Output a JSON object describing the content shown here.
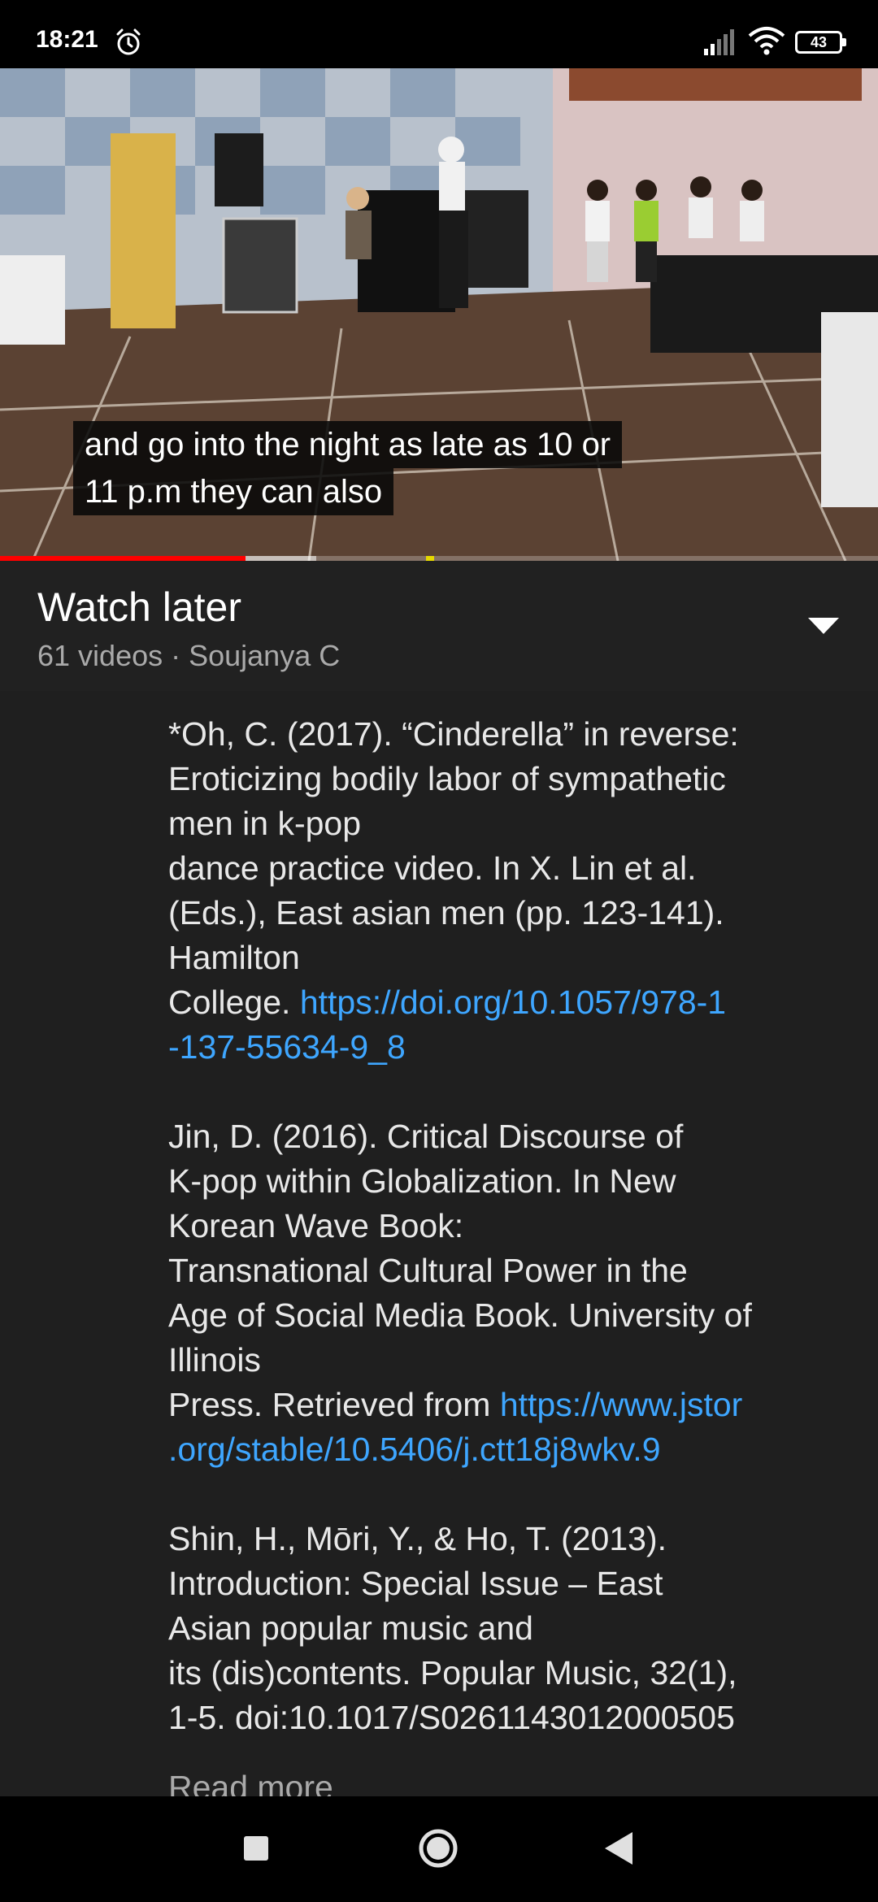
{
  "status_bar": {
    "time": "18:21",
    "battery_level": "43",
    "icons": [
      "alarm-icon",
      "signal-icon",
      "wifi-icon",
      "battery-icon"
    ]
  },
  "video": {
    "caption_lines": [
      "and go into the night as late as 10 or",
      "11 p.m they can also"
    ],
    "progress_played": 0.28,
    "progress_buffered": 0.36,
    "colors": {
      "played": "#ff0000",
      "buffered": "#bdbdbd"
    }
  },
  "playlist": {
    "title": "Watch later",
    "meta": "61 videos · Soujanya C"
  },
  "description": {
    "ref1": {
      "lines": [
        "*Oh, C. (2017). “Cinderella” in reverse:",
        "Eroticizing bodily labor of sympathetic",
        "men in k-pop",
        "dance practice video. In X. Lin et al.",
        "(Eds.), East asian men (pp. 123-141).",
        "Hamilton"
      ],
      "last_prefix": "College. ",
      "link_part1": "https://doi.org/10.1057/978-1",
      "link_part2": "-137-55634-9_8"
    },
    "ref2": {
      "lines": [
        "Jin, D. (2016). Critical Discourse of",
        "K-pop within Globalization. In New",
        "Korean Wave Book:",
        "Transnational Cultural Power in the",
        "Age of Social Media Book. University of",
        "Illinois"
      ],
      "last_prefix": "Press. Retrieved from ",
      "link_part1": "https://www.jstor",
      "link_part2": ".org/stable/10.5406/j.ctt18j8wkv.9"
    },
    "ref3": {
      "lines": [
        "Shin, H., Mōri, Y., & Ho, T. (2013).",
        "Introduction: Special Issue – East",
        "Asian popular music and",
        "its (dis)contents. Popular Music, 32(1),",
        "1-5. doi:10.1017/S0261143012000505"
      ]
    },
    "read_more": "Read more"
  },
  "colors": {
    "background": "#1f1f1f",
    "header_bg": "#212121",
    "link": "#3ea6ff",
    "secondary_text": "#aaaaaa"
  }
}
